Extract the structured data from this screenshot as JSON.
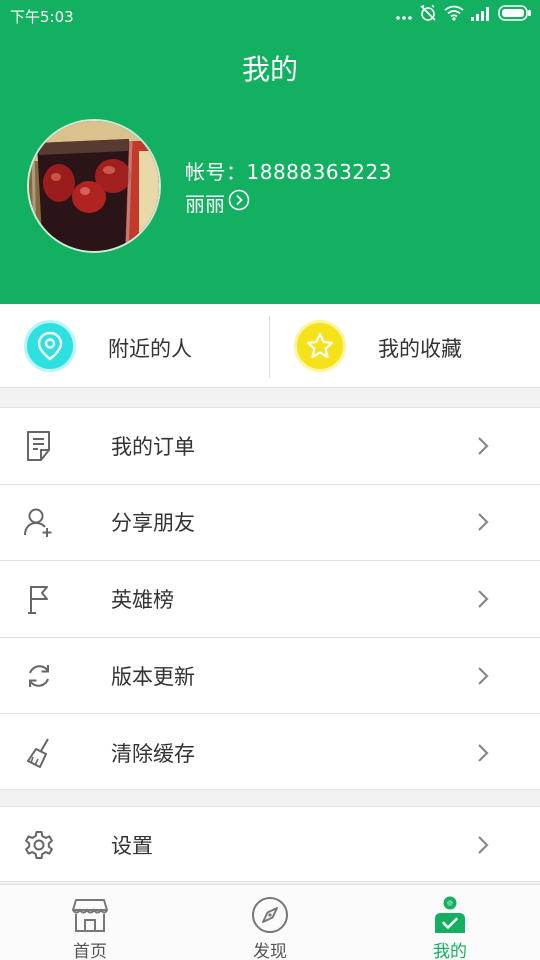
{
  "status_bar": {
    "time": "下午5:03",
    "icons": [
      "more-dots-icon",
      "alarm-off-icon",
      "wifi-icon",
      "signal-icon",
      "battery-icon"
    ]
  },
  "header": {
    "title": "我的",
    "account": "帐号：18888363223",
    "nickname": "丽丽"
  },
  "quick_actions": [
    {
      "label": "附近的人",
      "icon": "location-pin-icon",
      "color": "#2fe0e0"
    },
    {
      "label": "我的收藏",
      "icon": "star-icon",
      "color": "#f5e21a"
    }
  ],
  "menu": [
    {
      "label": "我的订单",
      "icon": "order-document-icon"
    },
    {
      "label": "分享朋友",
      "icon": "add-friend-icon"
    },
    {
      "label": "英雄榜",
      "icon": "flag-icon"
    },
    {
      "label": "版本更新",
      "icon": "refresh-icon"
    },
    {
      "label": "清除缓存",
      "icon": "broom-icon"
    }
  ],
  "menu2": [
    {
      "label": "设置",
      "icon": "gear-icon"
    }
  ],
  "tabs": [
    {
      "label": "首页",
      "icon": "store-icon",
      "active": false
    },
    {
      "label": "发现",
      "icon": "compass-icon",
      "active": false
    },
    {
      "label": "我的",
      "icon": "profile-icon",
      "active": true
    }
  ],
  "colors": {
    "brand": "#13b062",
    "text": "#333333",
    "divider": "#e2e2e2"
  }
}
